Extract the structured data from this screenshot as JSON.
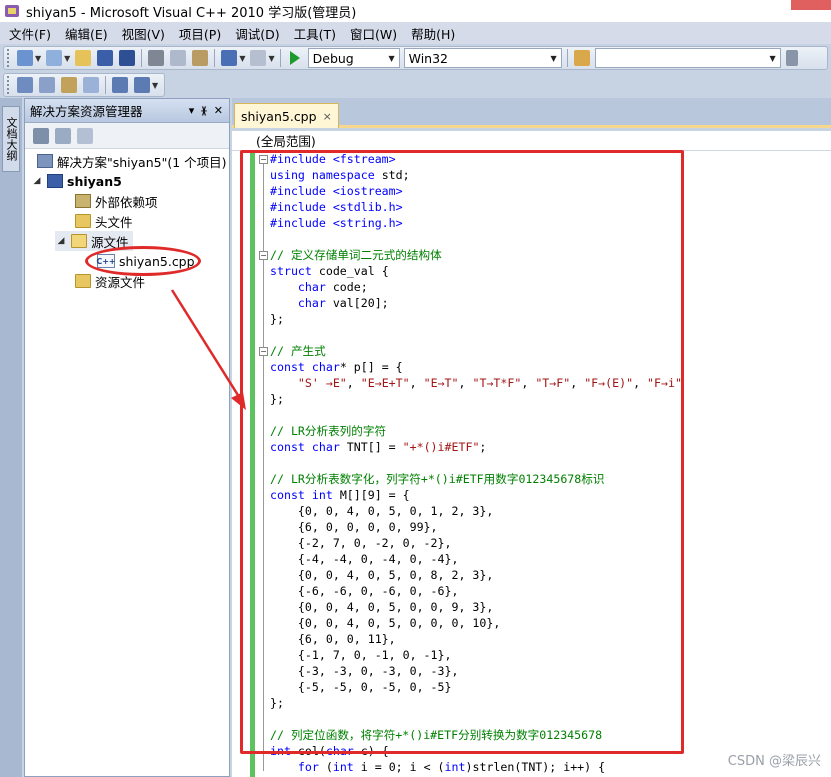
{
  "window": {
    "title": "shiyan5 - Microsoft Visual C++ 2010 学习版(管理员)"
  },
  "menu": [
    "文件(F)",
    "编辑(E)",
    "视图(V)",
    "项目(P)",
    "调试(D)",
    "工具(T)",
    "窗口(W)",
    "帮助(H)"
  ],
  "toolbar": {
    "config": "Debug",
    "platform": "Win32",
    "search_value": ""
  },
  "side_tab": "文档大纲",
  "solution_explorer": {
    "title": "解决方案资源管理器",
    "pin": "ᚕ",
    "close": "✕",
    "dropdown": "▾",
    "solution": "解决方案\"shiyan5\"(1 个项目)",
    "project": "shiyan5",
    "items": [
      "外部依赖项",
      "头文件",
      "源文件",
      "shiyan5.cpp",
      "资源文件"
    ]
  },
  "editor": {
    "tab_label": "shiyan5.cpp",
    "tab_close": "×",
    "scope": "(全局范围)"
  },
  "code": [
    [
      [
        "pp",
        "#include <fstream>"
      ]
    ],
    [
      [
        "kw",
        "using"
      ],
      [
        "",
        " "
      ],
      [
        "kw",
        "namespace"
      ],
      [
        "",
        " std;"
      ]
    ],
    [
      [
        "pp",
        "#include <iostream>"
      ]
    ],
    [
      [
        "pp",
        "#include <stdlib.h>"
      ]
    ],
    [
      [
        "pp",
        "#include <string.h>"
      ]
    ],
    [],
    [
      [
        "cm",
        "// 定义存储单词二元式的结构体"
      ]
    ],
    [
      [
        "kw",
        "struct"
      ],
      [
        "",
        " code_val {"
      ]
    ],
    [
      [
        "",
        "    "
      ],
      [
        "kw",
        "char"
      ],
      [
        "",
        " code;"
      ]
    ],
    [
      [
        "",
        "    "
      ],
      [
        "kw",
        "char"
      ],
      [
        "",
        " val[20];"
      ]
    ],
    [
      [
        "",
        "};"
      ]
    ],
    [],
    [
      [
        "cm",
        "// 产生式"
      ]
    ],
    [
      [
        "kw",
        "const"
      ],
      [
        "",
        " "
      ],
      [
        "kw",
        "char"
      ],
      [
        "",
        "* p[] = {"
      ]
    ],
    [
      [
        "",
        "    "
      ],
      [
        "st",
        "\"S' →E\""
      ],
      [
        "",
        ", "
      ],
      [
        "st",
        "\"E→E+T\""
      ],
      [
        "",
        ", "
      ],
      [
        "st",
        "\"E→T\""
      ],
      [
        "",
        ", "
      ],
      [
        "st",
        "\"T→T*F\""
      ],
      [
        "",
        ", "
      ],
      [
        "st",
        "\"T→F\""
      ],
      [
        "",
        ", "
      ],
      [
        "st",
        "\"F→(E)\""
      ],
      [
        "",
        ", "
      ],
      [
        "st",
        "\"F→i\""
      ]
    ],
    [
      [
        "",
        "};"
      ]
    ],
    [],
    [
      [
        "cm",
        "// LR分析表列的字符"
      ]
    ],
    [
      [
        "kw",
        "const"
      ],
      [
        "",
        " "
      ],
      [
        "kw",
        "char"
      ],
      [
        "",
        " TNT[] = "
      ],
      [
        "st",
        "\"+*()i#ETF\""
      ],
      [
        "",
        ";"
      ]
    ],
    [],
    [
      [
        "cm",
        "// LR分析表数字化，列字符+*()i#ETF用数字012345678标识"
      ]
    ],
    [
      [
        "kw",
        "const"
      ],
      [
        "",
        " "
      ],
      [
        "kw",
        "int"
      ],
      [
        "",
        " M[][9] = {"
      ]
    ],
    [
      [
        "",
        "    {0, 0, 4, 0, 5, 0, 1, 2, 3},"
      ]
    ],
    [
      [
        "",
        "    {6, 0, 0, 0, 0, 99},"
      ]
    ],
    [
      [
        "",
        "    {-2, 7, 0, -2, 0, -2},"
      ]
    ],
    [
      [
        "",
        "    {-4, -4, 0, -4, 0, -4},"
      ]
    ],
    [
      [
        "",
        "    {0, 0, 4, 0, 5, 0, 8, 2, 3},"
      ]
    ],
    [
      [
        "",
        "    {-6, -6, 0, -6, 0, -6},"
      ]
    ],
    [
      [
        "",
        "    {0, 0, 4, 0, 5, 0, 0, 9, 3},"
      ]
    ],
    [
      [
        "",
        "    {0, 0, 4, 0, 5, 0, 0, 0, 10},"
      ]
    ],
    [
      [
        "",
        "    {6, 0, 0, 11},"
      ]
    ],
    [
      [
        "",
        "    {-1, 7, 0, -1, 0, -1},"
      ]
    ],
    [
      [
        "",
        "    {-3, -3, 0, -3, 0, -3},"
      ]
    ],
    [
      [
        "",
        "    {-5, -5, 0, -5, 0, -5}"
      ]
    ],
    [
      [
        "",
        "};"
      ]
    ],
    [],
    [
      [
        "cm",
        "// 列定位函数，将字符+*()i#ETF分别转换为数字012345678"
      ]
    ],
    [
      [
        "kw",
        "int"
      ],
      [
        "",
        " col("
      ],
      [
        "kw",
        "char"
      ],
      [
        "",
        " c) {"
      ]
    ],
    [
      [
        "",
        "    "
      ],
      [
        "kw",
        "for"
      ],
      [
        "",
        " ("
      ],
      [
        "kw",
        "int"
      ],
      [
        "",
        " i = 0; i < ("
      ],
      [
        "kw",
        "int"
      ],
      [
        "",
        ")strlen(TNT); i++) {"
      ]
    ]
  ],
  "watermark": "CSDN @梁辰兴"
}
